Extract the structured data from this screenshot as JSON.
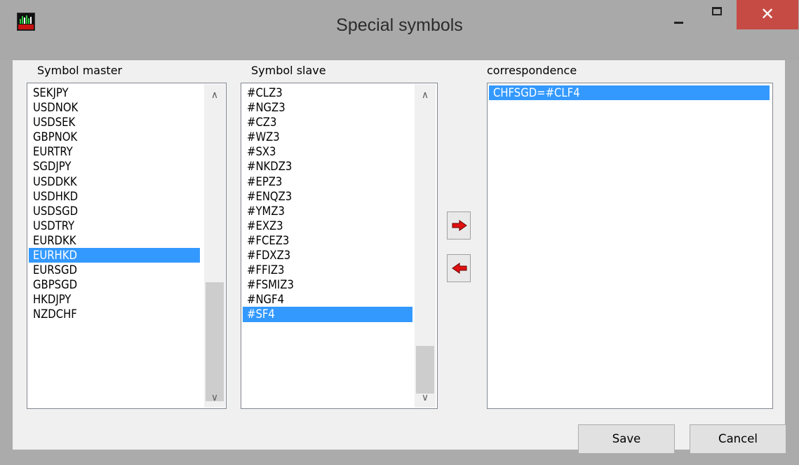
{
  "window": {
    "title": "Special symbols"
  },
  "title_buttons": {
    "minimize": "–",
    "maximize": "□",
    "close": "✕"
  },
  "master": {
    "label": "Symbol master",
    "items": [
      "SEKJPY",
      "USDNOK",
      "USDSEK",
      "GBPNOK",
      "EURTRY",
      "SGDJPY",
      "USDDKK",
      "USDHKD",
      "USDSGD",
      "USDTRY",
      "EURDKK",
      "EURHKD",
      "EURSGD",
      "GBPSGD",
      "HKDJPY",
      "NZDCHF"
    ],
    "selected": "EURHKD"
  },
  "slave": {
    "label": "Symbol slave",
    "items": [
      "#CLZ3",
      "#NGZ3",
      "#CZ3",
      "#WZ3",
      "#SX3",
      "#NKDZ3",
      "#EPZ3",
      "#ENQZ3",
      "#YMZ3",
      "#EXZ3",
      "#FCEZ3",
      "#FDXZ3",
      "#FFIZ3",
      "#FSMIZ3",
      "#NGF4",
      "#SF4"
    ],
    "selected": "#SF4"
  },
  "correspondence": {
    "label": "correspondence",
    "items": [
      "CHFSGD=#CLF4"
    ],
    "selected": "CHFSGD=#CLF4"
  },
  "buttons": {
    "save": "Save",
    "cancel": "Cancel"
  },
  "icons": {
    "add": "arrow-right-icon",
    "remove": "arrow-left-icon"
  },
  "colors": {
    "selection": "#3399ff",
    "close": "#c74b45",
    "arrow": "#e01010"
  }
}
